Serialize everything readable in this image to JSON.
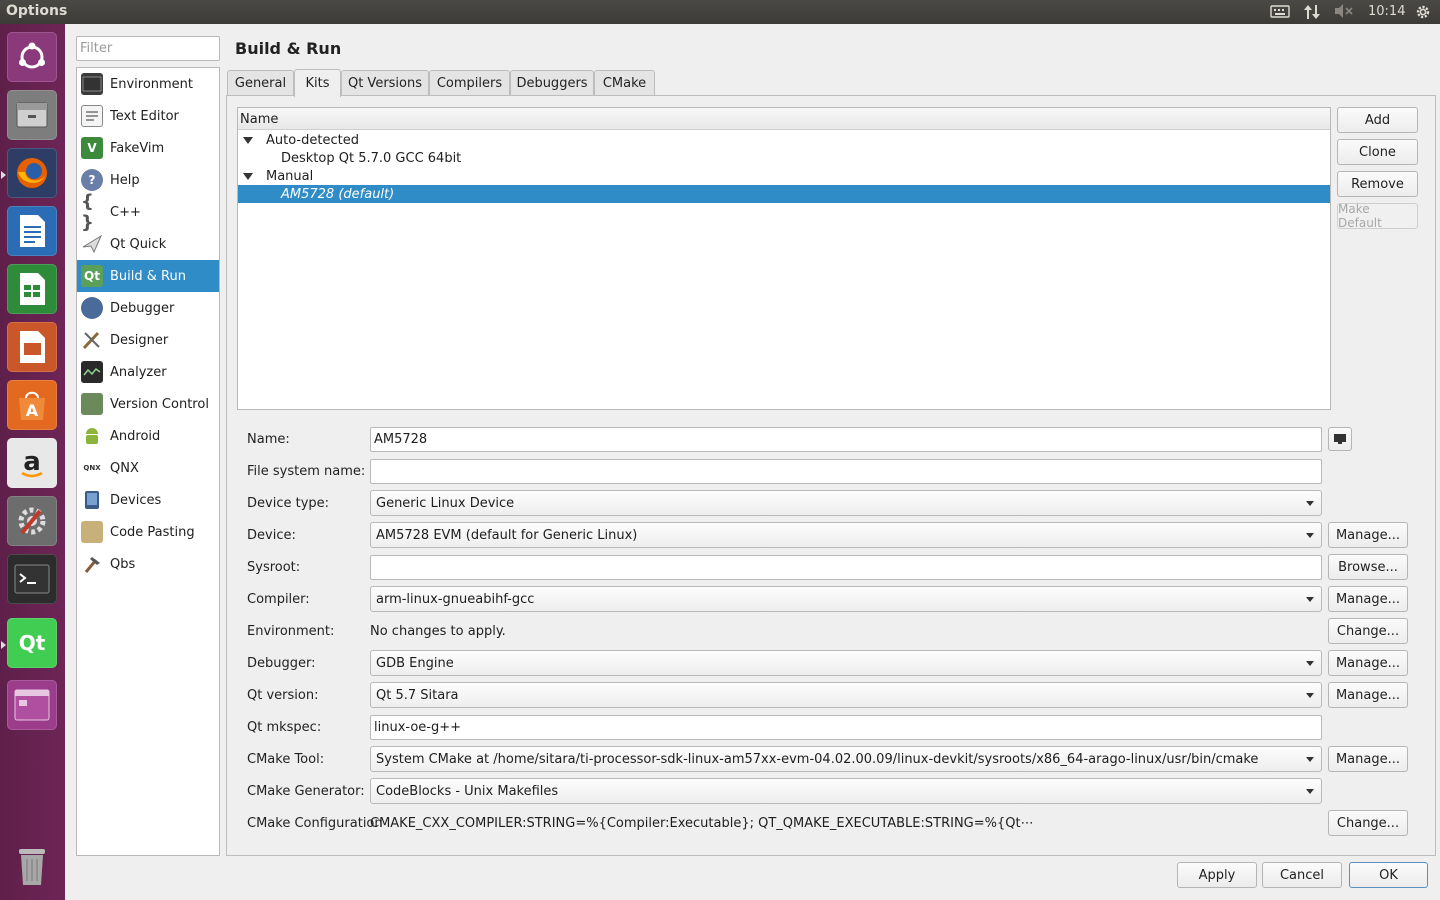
{
  "window": {
    "title": "Options"
  },
  "topbar": {
    "clock": "10:14",
    "icons": [
      "keyboard-icon",
      "network-icon",
      "volume-muted-icon",
      "settings-gear-icon"
    ]
  },
  "launcher": {
    "items": [
      {
        "name": "ubuntu-dash-icon",
        "color": "#8a3a7a"
      },
      {
        "name": "files-icon",
        "color": "#8d8d8d"
      },
      {
        "name": "firefox-icon",
        "color": "#e66000"
      },
      {
        "name": "writer-icon",
        "color": "#2a6db5"
      },
      {
        "name": "calc-icon",
        "color": "#2e8b3a"
      },
      {
        "name": "impress-icon",
        "color": "#c9572a"
      },
      {
        "name": "software-center-icon",
        "color": "#e2691f"
      },
      {
        "name": "amazon-icon",
        "color": "#dddddd"
      },
      {
        "name": "system-settings-icon",
        "color": "#7a7a7a"
      },
      {
        "name": "terminal-icon",
        "color": "#333333"
      },
      {
        "name": "qt-creator-icon",
        "color": "#41cd52"
      },
      {
        "name": "workspace-icon",
        "color": "#7b3a6e"
      },
      {
        "name": "trash-icon",
        "color": "#9a9a9a"
      }
    ]
  },
  "filter": {
    "placeholder": "Filter"
  },
  "categories": [
    {
      "label": "Environment",
      "icon": "environment-icon",
      "color": "#3a3a3a"
    },
    {
      "label": "Text Editor",
      "icon": "text-editor-icon",
      "color": "#6a6a6a"
    },
    {
      "label": "FakeVim",
      "icon": "fakevim-icon",
      "color": "#3c8a3c"
    },
    {
      "label": "Help",
      "icon": "help-icon",
      "color": "#6a7fa8"
    },
    {
      "label": "C++",
      "icon": "cpp-icon",
      "color": "#7a7a9a"
    },
    {
      "label": "Qt Quick",
      "icon": "qt-quick-icon",
      "color": "#9a9a9a"
    },
    {
      "label": "Build & Run",
      "icon": "build-run-icon",
      "color": "#5aa05a"
    },
    {
      "label": "Debugger",
      "icon": "debugger-icon",
      "color": "#4a6a9a"
    },
    {
      "label": "Designer",
      "icon": "designer-icon",
      "color": "#8a7a5a"
    },
    {
      "label": "Analyzer",
      "icon": "analyzer-icon",
      "color": "#2a2a2a"
    },
    {
      "label": "Version Control",
      "icon": "version-control-icon",
      "color": "#6a8a5a"
    },
    {
      "label": "Android",
      "icon": "android-icon",
      "color": "#8ab43a"
    },
    {
      "label": "QNX",
      "icon": "qnx-icon",
      "color": "#ffffff"
    },
    {
      "label": "Devices",
      "icon": "devices-icon",
      "color": "#3a5a8a"
    },
    {
      "label": "Code Pasting",
      "icon": "code-pasting-icon",
      "color": "#8a7a4a"
    },
    {
      "label": "Qbs",
      "icon": "qbs-icon",
      "color": "#8a5a3a"
    }
  ],
  "selected_category": "Build & Run",
  "page": {
    "title": "Build & Run"
  },
  "tabs": [
    "General",
    "Kits",
    "Qt Versions",
    "Compilers",
    "Debuggers",
    "CMake"
  ],
  "active_tab": "Kits",
  "kits_tree": {
    "header": "Name",
    "groups": [
      {
        "label": "Auto-detected",
        "children": [
          "Desktop Qt 5.7.0 GCC 64bit"
        ]
      },
      {
        "label": "Manual",
        "children": [
          "AM5728 (default)"
        ]
      }
    ],
    "selected": "AM5728 (default)"
  },
  "side_buttons": {
    "add": "Add",
    "clone": "Clone",
    "remove": "Remove",
    "make_default": "Make Default"
  },
  "form": {
    "name": {
      "label": "Name:",
      "value": "AM5728"
    },
    "fs_name": {
      "label": "File system name:",
      "value": ""
    },
    "device_type": {
      "label": "Device type:",
      "value": "Generic Linux Device"
    },
    "device": {
      "label": "Device:",
      "value": "AM5728 EVM (default for Generic Linux)",
      "button": "Manage..."
    },
    "sysroot": {
      "label": "Sysroot:",
      "value": "",
      "button": "Browse..."
    },
    "compiler": {
      "label": "Compiler:",
      "value": "arm-linux-gnueabihf-gcc",
      "button": "Manage..."
    },
    "environment": {
      "label": "Environment:",
      "value": "No changes to apply.",
      "button": "Change..."
    },
    "debugger": {
      "label": "Debugger:",
      "value": "GDB Engine",
      "button": "Manage..."
    },
    "qt_version": {
      "label": "Qt version:",
      "value": "Qt 5.7 Sitara",
      "button": "Manage..."
    },
    "qt_mkspec": {
      "label": "Qt mkspec:",
      "value": "linux-oe-g++"
    },
    "cmake_tool": {
      "label": "CMake Tool:",
      "value": "System CMake at /home/sitara/ti-processor-sdk-linux-am57xx-evm-04.02.00.09/linux-devkit/sysroots/x86_64-arago-linux/usr/bin/cmake",
      "button": "Manage..."
    },
    "cmake_generator": {
      "label": "CMake Generator:",
      "value": "CodeBlocks - Unix Makefiles"
    },
    "cmake_config": {
      "label": "CMake Configuration",
      "value": "CMAKE_CXX_COMPILER:STRING=%{Compiler:Executable}; QT_QMAKE_EXECUTABLE:STRING=%{Qt⋯",
      "button": "Change..."
    }
  },
  "dialog_buttons": {
    "apply": "Apply",
    "cancel": "Cancel",
    "ok": "OK"
  }
}
